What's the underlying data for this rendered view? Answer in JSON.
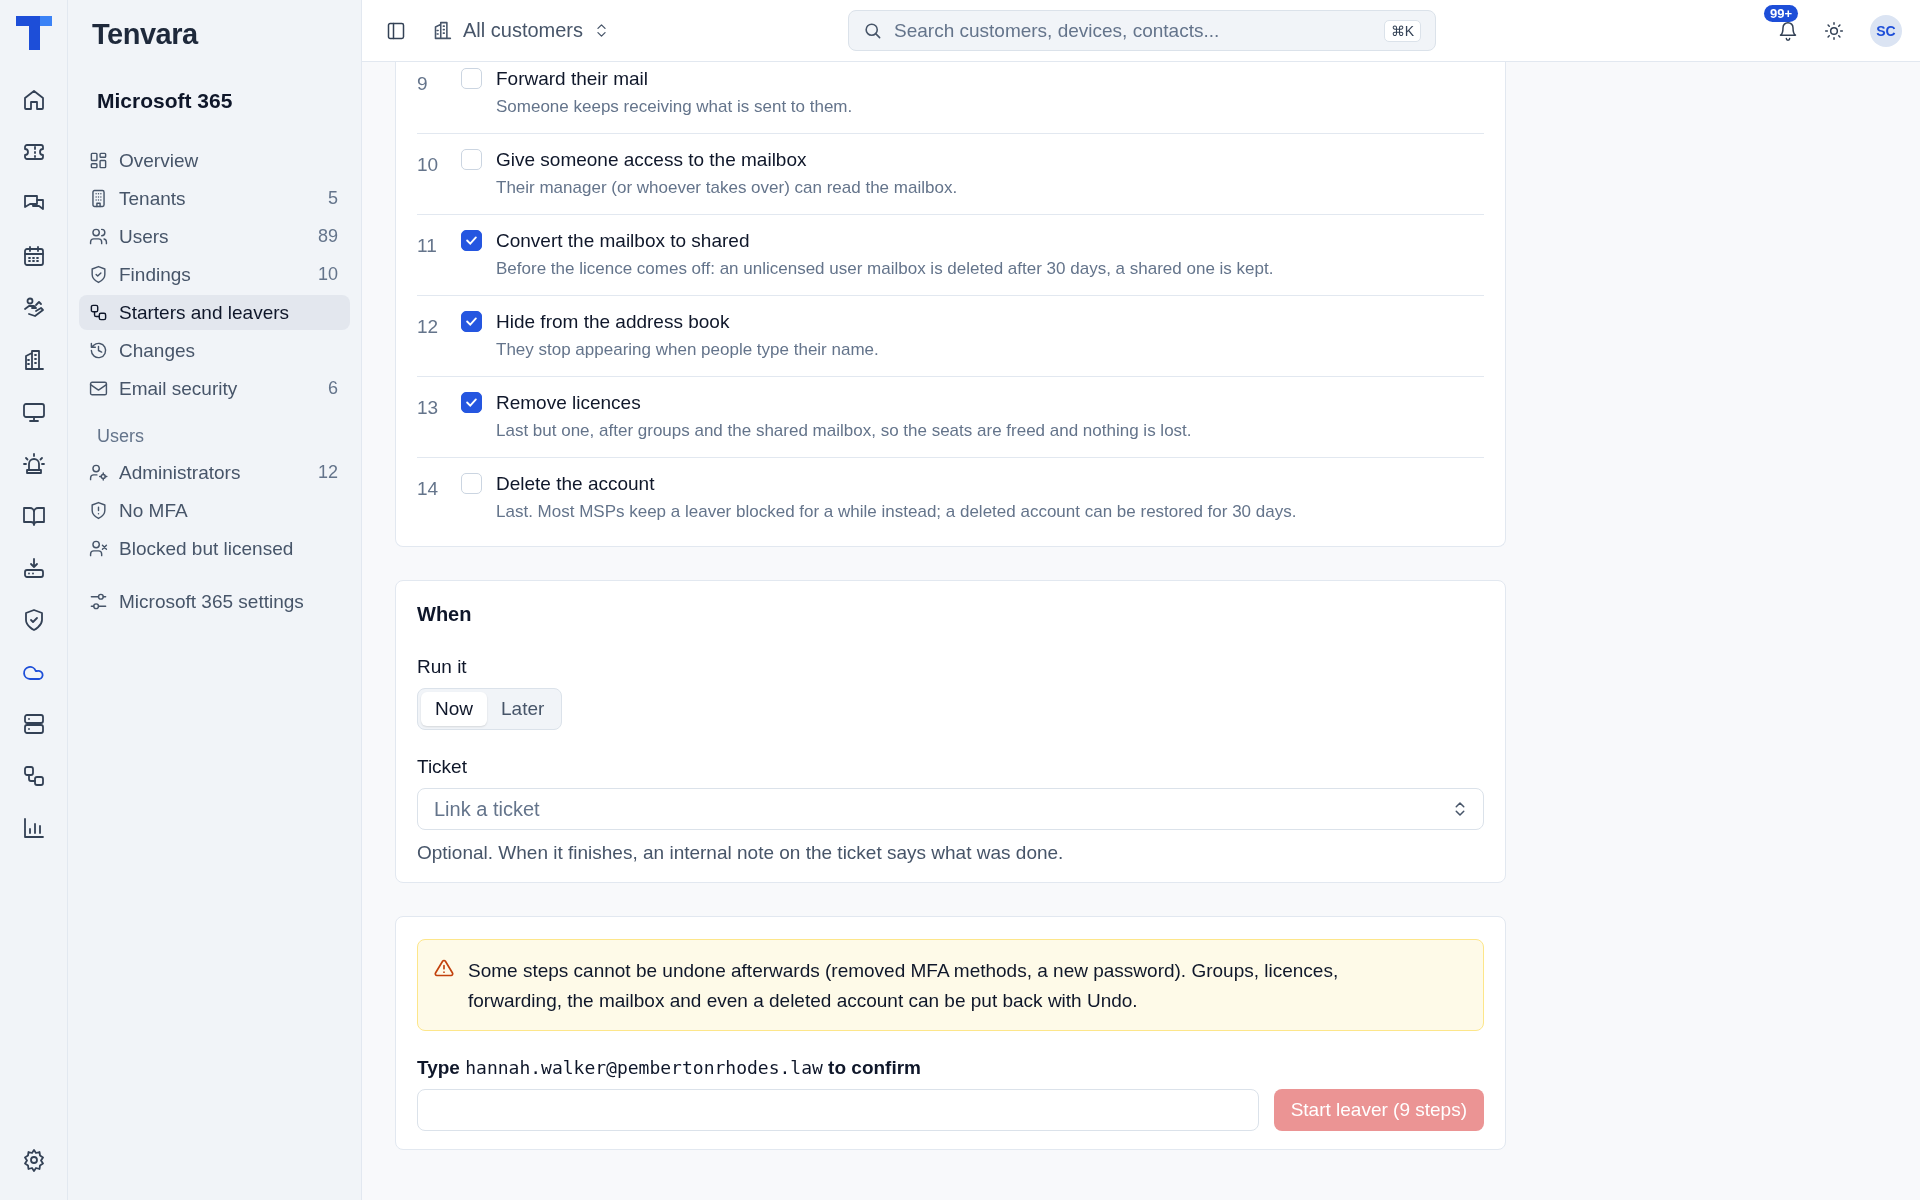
{
  "rail": {
    "items": [
      {
        "selected": false
      },
      {
        "selected": false
      },
      {
        "selected": false
      },
      {
        "selected": false
      },
      {
        "selected": false
      },
      {
        "selected": false
      },
      {
        "selected": false
      },
      {
        "selected": false
      },
      {
        "selected": false
      },
      {
        "selected": false
      },
      {
        "selected": false
      },
      {
        "selected": true
      },
      {
        "selected": false
      },
      {
        "selected": false
      },
      {
        "selected": false
      }
    ]
  },
  "sidebar": {
    "brand": "Tenvara",
    "title": "Microsoft 365",
    "items": [
      {
        "label": "Overview",
        "selected": false
      },
      {
        "label": "Tenants",
        "count": "5",
        "selected": false
      },
      {
        "label": "Users",
        "count": "89",
        "selected": false
      },
      {
        "label": "Findings",
        "count": "10",
        "selected": false
      },
      {
        "label": "Starters and leavers",
        "selected": true
      },
      {
        "label": "Changes",
        "selected": false
      },
      {
        "label": "Email security",
        "count": "6",
        "selected": false
      }
    ],
    "section": "Users",
    "section_items": [
      {
        "label": "Administrators",
        "count": "12",
        "selected": false
      },
      {
        "label": "No MFA",
        "selected": false
      },
      {
        "label": "Blocked but licensed",
        "selected": false
      }
    ],
    "settings": "Microsoft 365 settings"
  },
  "topbar": {
    "scope": "All customers",
    "search": {
      "placeholder": "Search customers, devices, contacts..."
    },
    "shortcut": "⌘K",
    "notifications": "99+",
    "avatar": "SC"
  },
  "steps": [
    {
      "number": "9",
      "title": "Forward their mail",
      "description": "Someone keeps receiving what is sent to them.",
      "checked": false
    },
    {
      "number": "10",
      "title": "Give someone access to the mailbox",
      "description": "Their manager (or whoever takes over) can read the mailbox.",
      "checked": false
    },
    {
      "number": "11",
      "title": "Convert the mailbox to shared",
      "description": "Before the licence comes off: an unlicensed user mailbox is deleted after 30 days, a shared one is kept.",
      "checked": true
    },
    {
      "number": "12",
      "title": "Hide from the address book",
      "description": "They stop appearing when people type their name.",
      "checked": true
    },
    {
      "number": "13",
      "title": "Remove licences",
      "description": "Last but one, after groups and the shared mailbox, so the seats are freed and nothing is lost.",
      "checked": true
    },
    {
      "number": "14",
      "title": "Delete the account",
      "description": "Last. Most MSPs keep a leaver blocked for a while instead; a deleted account can be restored for 30 days.",
      "checked": false
    }
  ],
  "when": {
    "title": "When",
    "run_label": "Run it",
    "options": [
      {
        "label": "Now",
        "selected": true
      },
      {
        "label": "Later",
        "selected": false
      }
    ],
    "ticket_label": "Ticket",
    "ticket": {
      "placeholder": "Link a ticket"
    },
    "hint": "Optional. When it finishes, an internal note on the ticket says what was done."
  },
  "confirm": {
    "warning": "Some steps cannot be undone afterwards (removed MFA methods, a new password). Groups, licences, forwarding, the mailbox and even a deleted account can be put back with Undo.",
    "prompt_before": "Type",
    "email": "hannah.walker@pembertonrhodes.law",
    "prompt_after": "to confirm",
    "button": "Start leaver (9 steps)",
    "disabled": true
  }
}
